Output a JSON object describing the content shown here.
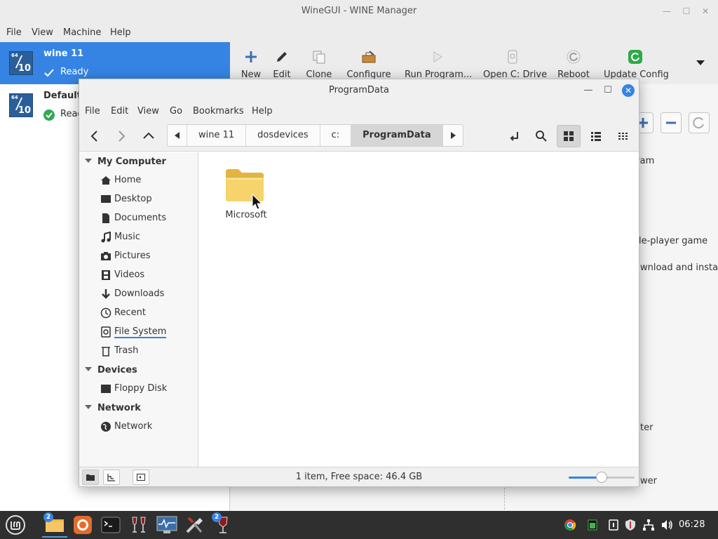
{
  "winegui": {
    "title": "WineGUI - WINE Manager",
    "menu": [
      "File",
      "View",
      "Machine",
      "Help"
    ],
    "machines": [
      {
        "name": "wine 11",
        "status": "Ready",
        "bits": "64",
        "version": "10"
      },
      {
        "name": "Default",
        "status": "Ready",
        "bits": "64",
        "version": "10"
      }
    ],
    "toolbar": {
      "new": "New",
      "edit": "Edit",
      "clone": "Clone",
      "configure": "Configure",
      "run_program": "Run Program...",
      "open_c_drive": "Open C: Drive",
      "reboot": "Reboot",
      "update_config": "Update Config"
    },
    "right_panel_text": [
      "gram",
      "le-player game",
      "wnload and insta",
      "ter",
      "wer"
    ]
  },
  "file_manager": {
    "title": "ProgramData",
    "menu": [
      "File",
      "Edit",
      "View",
      "Go",
      "Bookmarks",
      "Help"
    ],
    "breadcrumbs": [
      "wine 11",
      "dosdevices",
      "c:",
      "ProgramData"
    ],
    "places": {
      "my_computer": {
        "heading": "My Computer",
        "items": [
          "Home",
          "Desktop",
          "Documents",
          "Music",
          "Pictures",
          "Videos",
          "Downloads",
          "Recent",
          "File System",
          "Trash"
        ]
      },
      "devices": {
        "heading": "Devices",
        "items": [
          "Floppy Disk"
        ]
      },
      "network": {
        "heading": "Network",
        "items": [
          "Network"
        ]
      }
    },
    "items": [
      {
        "name": "Microsoft",
        "type": "folder"
      }
    ],
    "status": "1 item, Free space: 46.4 GB",
    "zoom_level": 0.5
  },
  "taskbar": {
    "badges": {
      "files": "2",
      "wine": "2"
    },
    "clock": "06:28"
  },
  "colors": {
    "accent": "#3584e4",
    "folder": "#f6d36b",
    "taskbar": "#2f2f2f"
  }
}
